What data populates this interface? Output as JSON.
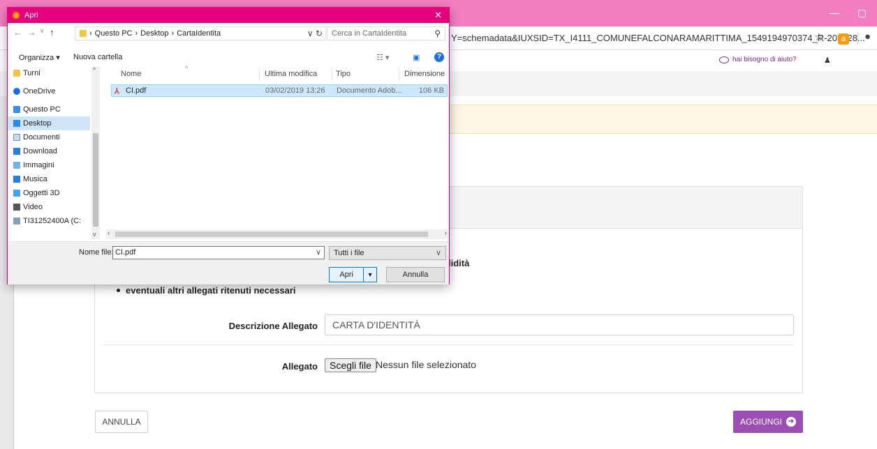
{
  "browser": {
    "url": "Y=schemadata&IUXSID=TX_I4111_COMUNEFALCONARAMARITTIMA_1549194970374_R-203428...",
    "accent": "#f27fc0"
  },
  "site": {
    "help_text": "hai bisogno di aiuto?",
    "validita_text": "lidità",
    "bullet_text": "eventuali altri allegati ritenuti necessari",
    "descrizione_label": "Descrizione Allegato",
    "descrizione_value": "CARTA D'IDENTITÀ",
    "allegato_label": "Allegato",
    "file_button": "Scegli file",
    "file_status": "Nessun file selezionato",
    "annulla_label": "ANNULLA",
    "aggiungi_label": "AGGIUNGI",
    "primary_color": "#9b4fb3"
  },
  "dialog": {
    "title": "Apri",
    "breadcrumb": [
      "Questo PC",
      "Desktop",
      "CartaIdentita"
    ],
    "search_placeholder": "Cerca in CartaIdentita",
    "toolbar": {
      "organize": "Organizza",
      "new_folder": "Nuova cartella"
    },
    "nav_items": [
      {
        "label": "Turni",
        "icon": "folder-icon"
      },
      {
        "label": "OneDrive",
        "icon": "cloud-icon"
      },
      {
        "label": "Questo PC",
        "icon": "pc-icon"
      },
      {
        "label": "Desktop",
        "icon": "desktop-icon",
        "selected": true
      },
      {
        "label": "Documenti",
        "icon": "documents-icon"
      },
      {
        "label": "Download",
        "icon": "download-icon"
      },
      {
        "label": "Immagini",
        "icon": "pictures-icon"
      },
      {
        "label": "Musica",
        "icon": "music-icon"
      },
      {
        "label": "Oggetti 3D",
        "icon": "objects3d-icon"
      },
      {
        "label": "Video",
        "icon": "video-icon"
      },
      {
        "label": "TI31252400A (C:",
        "icon": "drive-icon"
      }
    ],
    "columns": {
      "name": "Nome",
      "modified": "Ultima modifica",
      "type": "Tipo",
      "size": "Dimensione"
    },
    "files": [
      {
        "name": "CI.pdf",
        "modified": "03/02/2019 13:26",
        "type": "Documento Adob...",
        "size": "106 KB"
      }
    ],
    "filename_label": "Nome file:",
    "filename_value": "CI.pdf",
    "filter_value": "Tutti i file",
    "open_label": "Apri",
    "cancel_label": "Annulla"
  }
}
